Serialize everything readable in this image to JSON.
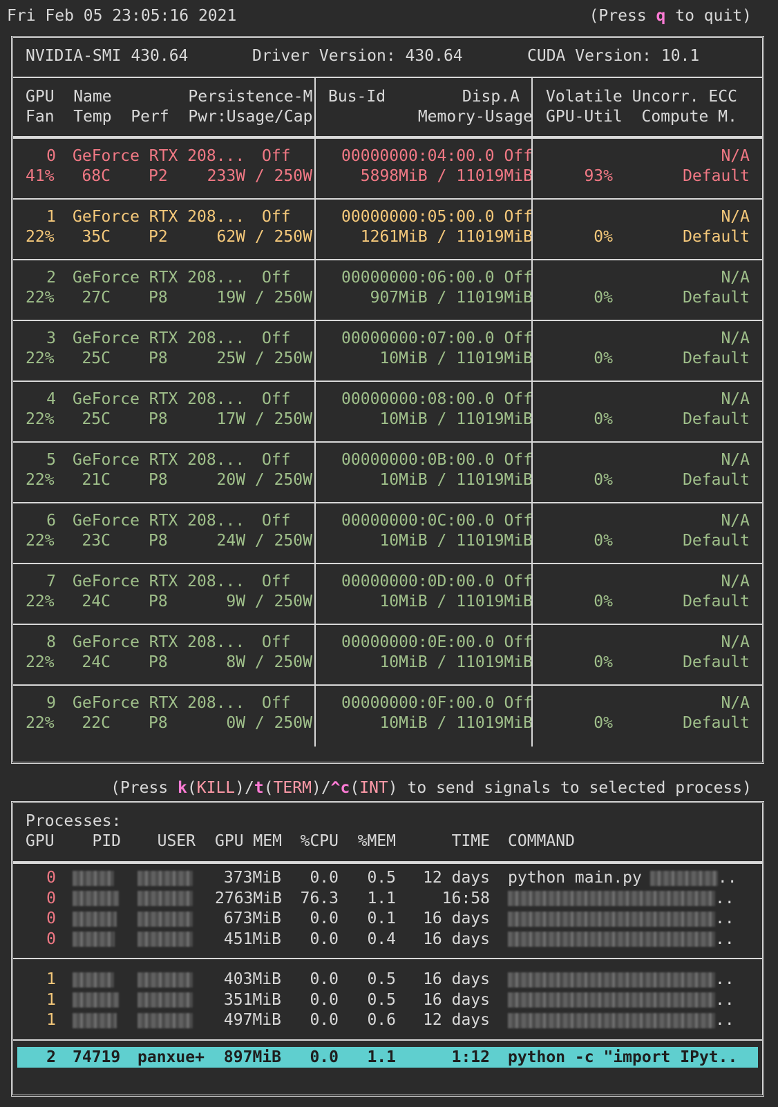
{
  "header": {
    "timestamp": "Fri Feb 05 23:05:16 2021",
    "quit_prefix": "(Press ",
    "quit_key": "q",
    "quit_suffix": " to quit)"
  },
  "smi": {
    "version": "NVIDIA-SMI 430.64",
    "driver": "Driver Version: 430.64",
    "cuda": "CUDA Version: 10.1"
  },
  "columns": {
    "c1a": "GPU  Name        Persistence-M",
    "c1b": "Fan  Temp  Perf  Pwr:Usage/Cap",
    "c2a": "Bus-Id        Disp.A",
    "c2b": "Memory-Usage",
    "c3a": "Volatile Uncorr. ECC",
    "c3b": "GPU-Util  Compute M."
  },
  "gpus": [
    {
      "idx": "0",
      "name": "GeForce RTX 208...",
      "persist": "Off",
      "fan": "41%",
      "temp": "68C",
      "perf": "P2",
      "pwr": "233W / 250W",
      "bus": "00000000:04:00.0 Off",
      "mem": "5898MiB / 11019MiB",
      "ecc": "N/A",
      "util": "93%",
      "compute": "Default",
      "color": "#f07884"
    },
    {
      "idx": "1",
      "name": "GeForce RTX 208...",
      "persist": "Off",
      "fan": "22%",
      "temp": "35C",
      "perf": "P2",
      "pwr": "62W / 250W",
      "bus": "00000000:05:00.0 Off",
      "mem": "1261MiB / 11019MiB",
      "ecc": "N/A",
      "util": "0%",
      "compute": "Default",
      "color": "#f4c87a"
    },
    {
      "idx": "2",
      "name": "GeForce RTX 208...",
      "persist": "Off",
      "fan": "22%",
      "temp": "27C",
      "perf": "P8",
      "pwr": "19W / 250W",
      "bus": "00000000:06:00.0 Off",
      "mem": "907MiB / 11019MiB",
      "ecc": "N/A",
      "util": "0%",
      "compute": "Default",
      "color": "#9fbf8a"
    },
    {
      "idx": "3",
      "name": "GeForce RTX 208...",
      "persist": "Off",
      "fan": "22%",
      "temp": "25C",
      "perf": "P8",
      "pwr": "25W / 250W",
      "bus": "00000000:07:00.0 Off",
      "mem": "10MiB / 11019MiB",
      "ecc": "N/A",
      "util": "0%",
      "compute": "Default",
      "color": "#9fbf8a"
    },
    {
      "idx": "4",
      "name": "GeForce RTX 208...",
      "persist": "Off",
      "fan": "22%",
      "temp": "25C",
      "perf": "P8",
      "pwr": "17W / 250W",
      "bus": "00000000:08:00.0 Off",
      "mem": "10MiB / 11019MiB",
      "ecc": "N/A",
      "util": "0%",
      "compute": "Default",
      "color": "#9fbf8a"
    },
    {
      "idx": "5",
      "name": "GeForce RTX 208...",
      "persist": "Off",
      "fan": "22%",
      "temp": "21C",
      "perf": "P8",
      "pwr": "20W / 250W",
      "bus": "00000000:0B:00.0 Off",
      "mem": "10MiB / 11019MiB",
      "ecc": "N/A",
      "util": "0%",
      "compute": "Default",
      "color": "#9fbf8a"
    },
    {
      "idx": "6",
      "name": "GeForce RTX 208...",
      "persist": "Off",
      "fan": "22%",
      "temp": "23C",
      "perf": "P8",
      "pwr": "24W / 250W",
      "bus": "00000000:0C:00.0 Off",
      "mem": "10MiB / 11019MiB",
      "ecc": "N/A",
      "util": "0%",
      "compute": "Default",
      "color": "#9fbf8a"
    },
    {
      "idx": "7",
      "name": "GeForce RTX 208...",
      "persist": "Off",
      "fan": "22%",
      "temp": "24C",
      "perf": "P8",
      "pwr": "9W / 250W",
      "bus": "00000000:0D:00.0 Off",
      "mem": "10MiB / 11019MiB",
      "ecc": "N/A",
      "util": "0%",
      "compute": "Default",
      "color": "#9fbf8a"
    },
    {
      "idx": "8",
      "name": "GeForce RTX 208...",
      "persist": "Off",
      "fan": "22%",
      "temp": "24C",
      "perf": "P8",
      "pwr": "8W / 250W",
      "bus": "00000000:0E:00.0 Off",
      "mem": "10MiB / 11019MiB",
      "ecc": "N/A",
      "util": "0%",
      "compute": "Default",
      "color": "#9fbf8a"
    },
    {
      "idx": "9",
      "name": "GeForce RTX 208...",
      "persist": "Off",
      "fan": "22%",
      "temp": "22C",
      "perf": "P8",
      "pwr": "0W / 250W",
      "bus": "00000000:0F:00.0 Off",
      "mem": "10MiB / 11019MiB",
      "ecc": "N/A",
      "util": "0%",
      "compute": "Default",
      "color": "#9fbf8a"
    }
  ],
  "signals": {
    "prefix": "(Press ",
    "k": "k",
    "kill": "KILL",
    "t": "t",
    "term": "TERM",
    "c": "^c",
    "int": "INT",
    "suffix": " to send signals to selected process)"
  },
  "processes": {
    "title": "Processes:",
    "headers": [
      "GPU",
      "PID",
      "USER",
      "GPU MEM",
      "%CPU",
      "%MEM",
      "TIME",
      "COMMAND"
    ],
    "groups": [
      {
        "color": "#f07884",
        "rows": [
          {
            "gpu": "0",
            "mem": "373MiB",
            "cpu": "0.0",
            "pmem": "0.5",
            "time": "12 days",
            "cmd": "python main.py"
          },
          {
            "gpu": "0",
            "mem": "2763MiB",
            "cpu": "76.3",
            "pmem": "1.1",
            "time": "16:58",
            "cmd": ""
          },
          {
            "gpu": "0",
            "mem": "673MiB",
            "cpu": "0.0",
            "pmem": "0.1",
            "time": "16 days",
            "cmd": ""
          },
          {
            "gpu": "0",
            "mem": "451MiB",
            "cpu": "0.0",
            "pmem": "0.4",
            "time": "16 days",
            "cmd": ""
          }
        ]
      },
      {
        "color": "#f4c87a",
        "rows": [
          {
            "gpu": "1",
            "mem": "403MiB",
            "cpu": "0.0",
            "pmem": "0.5",
            "time": "16 days",
            "cmd": ""
          },
          {
            "gpu": "1",
            "mem": "351MiB",
            "cpu": "0.0",
            "pmem": "0.5",
            "time": "16 days",
            "cmd": ""
          },
          {
            "gpu": "1",
            "mem": "497MiB",
            "cpu": "0.0",
            "pmem": "0.6",
            "time": "12 days",
            "cmd": ""
          }
        ]
      }
    ],
    "selected": {
      "gpu": "2",
      "pid": "74719",
      "user": "panxue+",
      "mem": "897MiB",
      "cpu": "0.0",
      "pmem": "1.1",
      "time": "1:12",
      "cmd": "python -c \"import IPyt.."
    },
    "ellipsis": ".."
  }
}
